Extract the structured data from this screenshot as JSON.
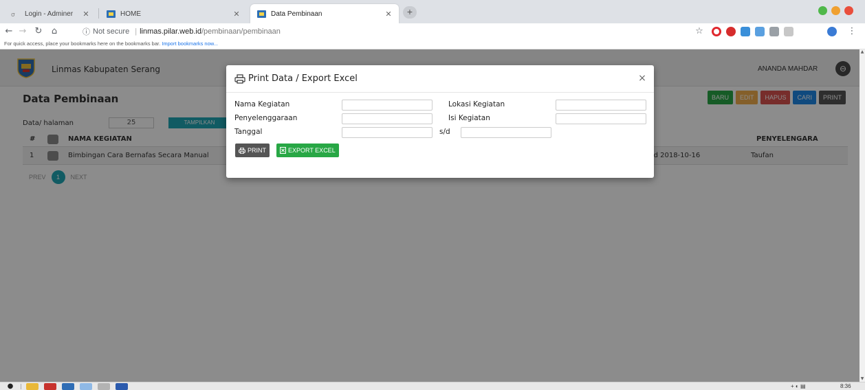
{
  "browser": {
    "tabs": [
      {
        "title": "Login - Adminer",
        "favicon": "adminer-icon"
      },
      {
        "title": "HOME",
        "favicon": "site-icon"
      },
      {
        "title": "Data Pembinaan",
        "favicon": "site-icon",
        "active": true
      }
    ],
    "new_tab_label": "+",
    "address": {
      "security": "Not secure",
      "host": "linmas.pilar.web.id",
      "path": "/pembinaan/pembinaan"
    },
    "bookmarks_text": "For quick access, place your bookmarks here on the bookmarks bar.",
    "bookmarks_link": "Import bookmarks now..."
  },
  "app": {
    "title": "Linmas Kabupaten Serang",
    "user": "ANANDA MAHDAR"
  },
  "page": {
    "title": "Data Pembinaan",
    "toolbar": [
      "BARU",
      "EDIT",
      "HAPUS",
      "CARI",
      "PRINT"
    ],
    "per_page_label": "Data/ halaman",
    "per_page_value": "25",
    "tampil_label": "TAMPILKAN",
    "table": {
      "headers": {
        "num": "#",
        "name": "NAMA KEGIATAN",
        "organizer": "PENYELENGARA"
      },
      "rows": [
        {
          "num": "1",
          "name": "Bimbingan Cara Bernafas Secara Manual",
          "date": "s/d 2018-10-16",
          "organizer": "Taufan"
        }
      ]
    },
    "pager": {
      "prev": "PREV",
      "current": "1",
      "next": "NEXT"
    }
  },
  "modal": {
    "title": "Print Data / Export Excel",
    "close": "×",
    "fields": {
      "nama_kegiatan": "Nama Kegiatan",
      "lokasi_kegiatan": "Lokasi Kegiatan",
      "penyelenggaraan": "Penyelenggaraan",
      "isi_kegiatan": "Isi Kegiatan",
      "tanggal": "Tanggal",
      "sd": "s/d"
    },
    "buttons": {
      "print": "PRINT",
      "export": "EXPORT EXCEL"
    }
  },
  "taskbar": {
    "time": "8:36"
  },
  "colors": {
    "teal": "#1fa6b5",
    "green": "#28a745",
    "yellow": "#f0ad4e",
    "red": "#d9534f",
    "blue": "#1e88e5",
    "dark": "#555555"
  }
}
